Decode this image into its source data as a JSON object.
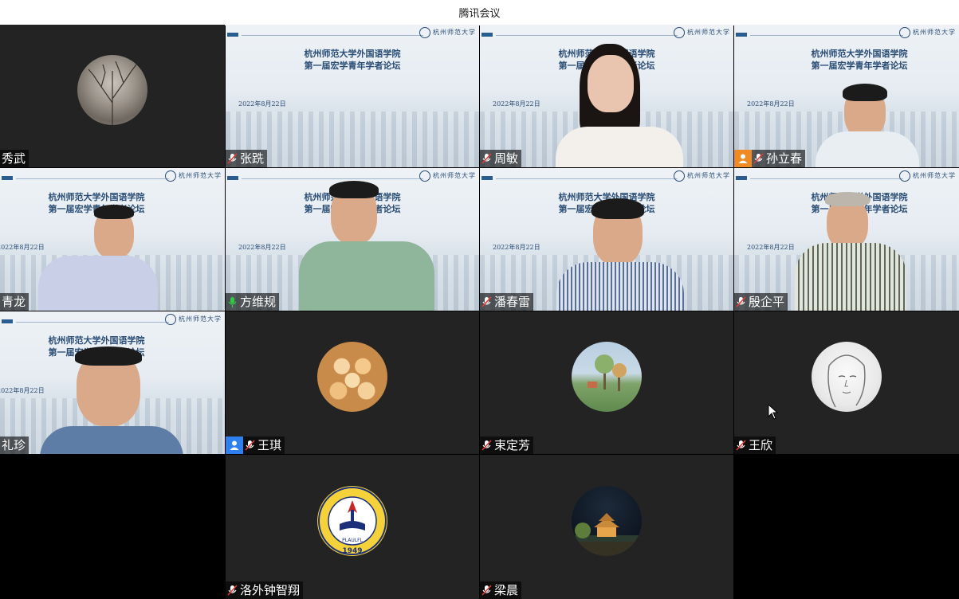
{
  "window": {
    "title": "腾讯会议"
  },
  "slide": {
    "line1": "杭州师范大学外国语学院",
    "line2": "第一届宏学青年学者论坛",
    "date": "2022年8月22日",
    "logo_text": "杭州师范大学"
  },
  "participants": [
    {
      "name": "秀武",
      "mic": "none",
      "video": false,
      "avatar": "tree-photo"
    },
    {
      "name": "张跣",
      "mic": "muted",
      "video": false,
      "avatar": "slide"
    },
    {
      "name": "周敏",
      "mic": "muted",
      "video": true
    },
    {
      "name": "孙立春",
      "mic": "muted",
      "video": true,
      "badge": "host"
    },
    {
      "name": "青龙",
      "mic": "none",
      "video": true
    },
    {
      "name": "方维规",
      "mic": "speaking",
      "video": true,
      "active_speaker": true
    },
    {
      "name": "潘春雷",
      "mic": "muted",
      "video": true
    },
    {
      "name": "殷企平",
      "mic": "muted",
      "video": true
    },
    {
      "name": "礼珍",
      "mic": "none",
      "video": true
    },
    {
      "name": "王琪",
      "mic": "muted",
      "video": false,
      "badge": "cohost",
      "avatar": "roses-photo"
    },
    {
      "name": "束定芳",
      "mic": "muted",
      "video": false,
      "avatar": "painting-photo"
    },
    {
      "name": "王欣",
      "mic": "muted",
      "video": false,
      "avatar": "sketch-face"
    },
    {
      "name": "洛外钟智翔",
      "mic": "muted",
      "video": false,
      "avatar": "university-emblem",
      "emblem_year": "1949",
      "emblem_text": "PLAULFL"
    },
    {
      "name": "梁晨",
      "mic": "muted",
      "video": false,
      "avatar": "pavilion-night-photo"
    }
  ],
  "colors": {
    "speaking": "#2ecc40",
    "muted_icon": "#ffffff",
    "host_badge": "#f08a24",
    "cohost_badge": "#2e7ff0",
    "tile_bg": "#232323"
  }
}
